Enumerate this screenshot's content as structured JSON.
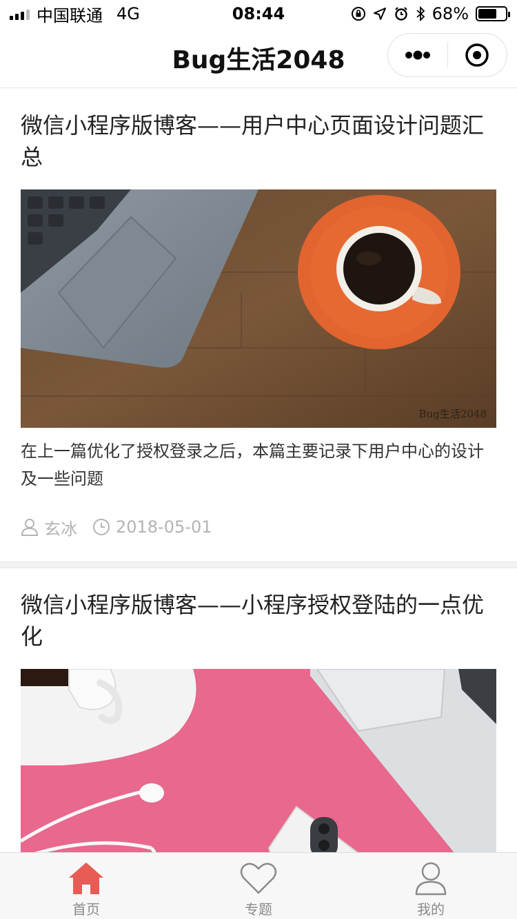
{
  "status_bar": {
    "carrier": "中国联通",
    "network": "4G",
    "time": "08:44",
    "battery_text": "68%",
    "battery_level": 0.68
  },
  "nav": {
    "title": "Bug生活2048"
  },
  "posts": [
    {
      "title": "微信小程序版博客——用户中心页面设计问题汇总",
      "watermark": "Bug生活2048",
      "excerpt": "在上一篇优化了授权登录之后，本篇主要记录下用户中心的设计及一些问题",
      "author": "玄冰",
      "date": "2018-05-01"
    },
    {
      "title": "微信小程序版博客——小程序授权登陆的一点优化"
    }
  ],
  "tabbar": {
    "items": [
      {
        "label": "首页",
        "icon": "home-icon",
        "active": true
      },
      {
        "label": "专题",
        "icon": "heart-icon",
        "active": false
      },
      {
        "label": "我的",
        "icon": "user-icon",
        "active": false
      }
    ]
  },
  "colors": {
    "accent": "#e85c56",
    "tab_inactive": "#8a8a8a",
    "meta": "#b3b3b3"
  }
}
